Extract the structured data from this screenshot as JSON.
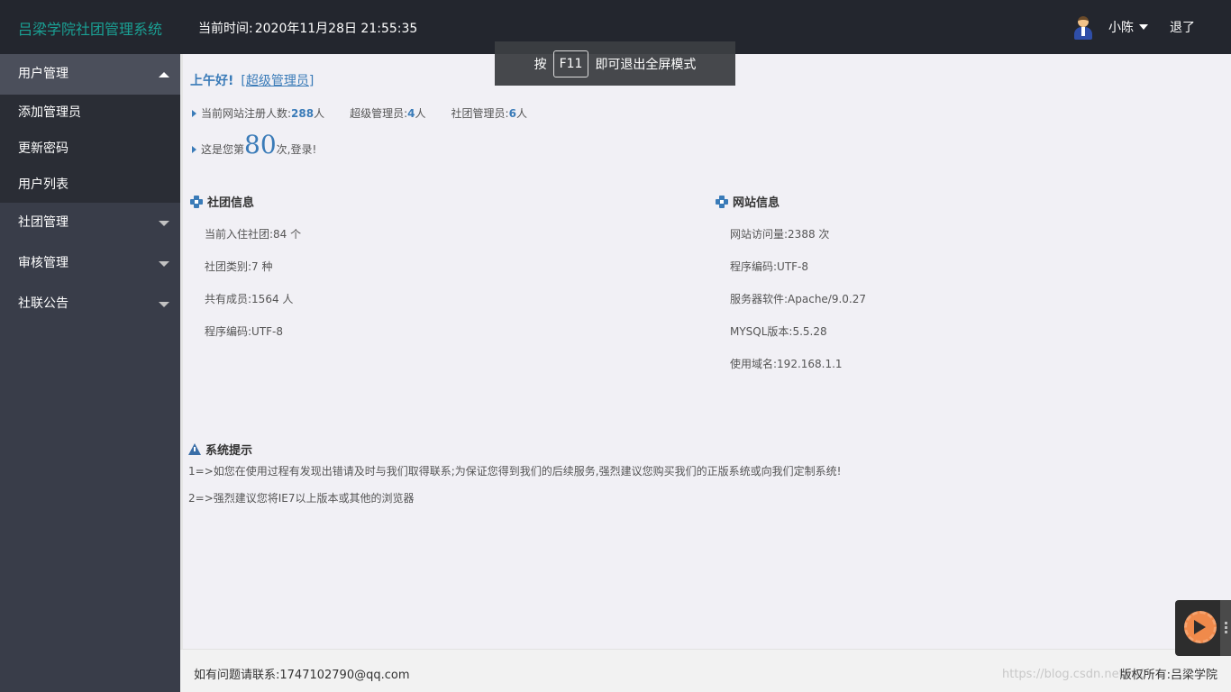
{
  "header": {
    "brand": "吕梁学院社团管理系统",
    "time_label": "当前时间:",
    "time_value": "2020年11月28日 21:55:35",
    "username": "小陈",
    "logout": "退了"
  },
  "fullscreen_tip": {
    "prefix": "按",
    "key": "F11",
    "suffix": "即可退出全屏模式"
  },
  "sidebar": {
    "groups": [
      {
        "label": "用户管理",
        "expanded": true,
        "items": [
          "添加管理员",
          "更新密码",
          "用户列表"
        ]
      },
      {
        "label": "社团管理",
        "expanded": false
      },
      {
        "label": "审核管理",
        "expanded": false
      },
      {
        "label": "社联公告",
        "expanded": false
      }
    ]
  },
  "greeting": {
    "text": "上午好!",
    "role": "[超级管理员]"
  },
  "stats": {
    "registered_label": "当前网站注册人数:",
    "registered_value": "288",
    "registered_unit": "人",
    "super_admin_label": "超级管理员:",
    "super_admin_value": "4",
    "super_admin_unit": "人",
    "club_admin_label": "社团管理员:",
    "club_admin_value": "6",
    "club_admin_unit": "人",
    "login_prefix": "这是您第",
    "login_count": "80",
    "login_suffix": "次,登录!"
  },
  "club_info": {
    "title": "社团信息",
    "rows": [
      "当前入住社团:84 个",
      "社团类别:7 种",
      "共有成员:1564 人",
      "程序编码:UTF-8"
    ]
  },
  "site_info": {
    "title": "网站信息",
    "rows": [
      "网站访问量:2388 次",
      "程序编码:UTF-8",
      "服务器软件:Apache/9.0.27",
      "MYSQL版本:5.5.28",
      "使用域名:192.168.1.1"
    ]
  },
  "system_tips": {
    "title": "系统提示",
    "lines": [
      "1=>如您在使用过程有发现出错请及时与我们取得联系;为保证您得到我们的后续服务,强烈建议您购买我们的正版系统或向我们定制系统!",
      "2=>强烈建议您将IE7以上版本或其他的浏览器"
    ]
  },
  "footer": {
    "contact": "如有问题请联系:1747102790@qq.com",
    "copyright": "版权所有:吕梁学院",
    "watermark": "https://blog.csdn.net/m0"
  },
  "colors": {
    "header_bg": "#23262e",
    "sidebar_bg": "#393d49",
    "brand": "#1aa094",
    "accent": "#3a7bb8"
  }
}
